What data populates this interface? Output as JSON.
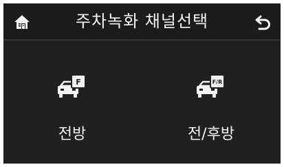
{
  "header": {
    "title": "주차녹화 채널선택",
    "home_icon": "home-icon",
    "back_icon": "back-arrow-icon"
  },
  "options": [
    {
      "label": "전방",
      "icon": "car-front-camera-icon",
      "badge": "F"
    },
    {
      "label": "전/후방",
      "icon": "car-front-rear-camera-icon",
      "badge": "F/R"
    }
  ],
  "colors": {
    "background": "#202020",
    "header_background": "#1b1b1b",
    "text": "#f0f0f0",
    "divider": "#353535"
  }
}
